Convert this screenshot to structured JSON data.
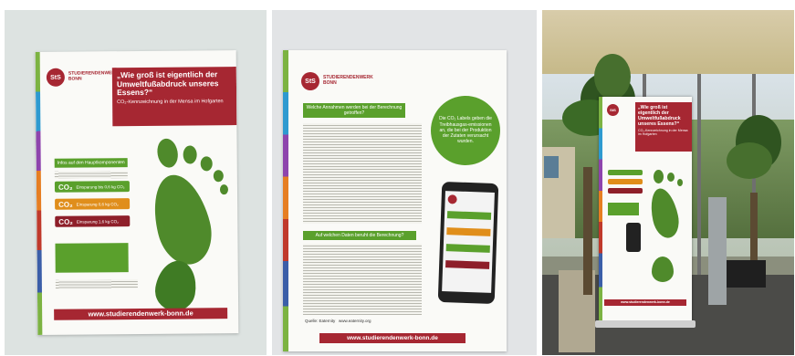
{
  "poster1": {
    "logo": "StS",
    "org_line1": "STUDIERENDENWERK",
    "org_line2": "BONN",
    "title": "„Wie groß ist eigentlich der Umweltfußabdruck unseres Essens?“",
    "subtitle": "CO₂-Kennzeichnung in der Mensa im Hofgarten",
    "legend_heading": "Infos auf den Hauptkomponenten",
    "co2_badges": [
      {
        "label": "CO₂",
        "text": "Einsparung bis 0,6 kg CO₂"
      },
      {
        "label": "CO₂",
        "text": "Einsparung 0,6 kg CO₂"
      },
      {
        "label": "CO₂",
        "text": "Einsparung 1,6 kg CO₂"
      }
    ],
    "url": "www.studierendenwerk-bonn.de"
  },
  "poster2": {
    "logo": "StS",
    "org_line1": "STUDIERENDENWERK",
    "org_line2": "BONN",
    "heading1": "Welche Annahmen werden bei der Berechnung getroffen?",
    "bubble": "Die CO₂ Labels geben die Treibhausgas-emissionen an, die bei der Produktion der Zutaten verursacht wurden.",
    "heading2": "Auf welchen Daten beruht die Berechnung?",
    "source": "Quelle: Eaternity",
    "source_url": "www.eaternity.org",
    "url": "www.studierendenwerk-bonn.de"
  },
  "rollup": {
    "title": "„Wie groß ist eigentlich der Umweltfußabdruck unseres Essens?“",
    "subtitle": "CO₂-Kennzeichnung in der Mensa im Hofgarten",
    "url": "www.studierendenwerk-bonn.de"
  },
  "colors": {
    "brand_red": "#a62732",
    "leaf_green": "#4f8a2b",
    "label_green": "#5aa02c",
    "label_orange": "#e08e1b",
    "label_darkred": "#8e1f2a"
  }
}
